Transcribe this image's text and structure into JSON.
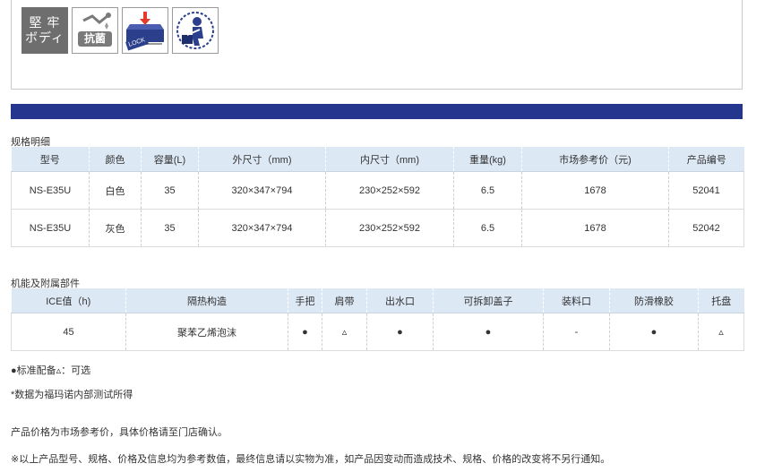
{
  "features": {
    "sturdy_label_line1": "堅 牢",
    "sturdy_label_line2": "ボディ",
    "antibac_label": "抗菌",
    "lock_label": "LOCK"
  },
  "spec": {
    "title": "规格明细",
    "headers": [
      "型号",
      "颜色",
      "容量(L)",
      "外尺寸（mm)",
      "内尺寸（mm)",
      "重量(kg)",
      "市场参考价（元)",
      "产品编号"
    ],
    "rows": [
      [
        "NS-E35U",
        "白色",
        "35",
        "320×347×794",
        "230×252×592",
        "6.5",
        "1678",
        "52041"
      ],
      [
        "NS-E35U",
        "灰色",
        "35",
        "320×347×794",
        "230×252×592",
        "6.5",
        "1678",
        "52042"
      ]
    ]
  },
  "functions": {
    "title": "机能及附属部件",
    "headers": [
      "ICE值（h)",
      "隔热构造",
      "手把",
      "肩带",
      "出水口",
      "可拆卸盖子",
      "装料口",
      "防滑橡胶",
      "托盘"
    ],
    "rows": [
      [
        "45",
        "聚苯乙烯泡沫",
        "●",
        "▵",
        "●",
        "●",
        "-",
        "●",
        "▵"
      ]
    ]
  },
  "notes": {
    "legend": "●标准配备▵：可选",
    "data_source": "*数据为福玛诺内部测试所得",
    "price_note": "产品价格为市场参考价，具体价格请至门店确认。",
    "disclaimer": "※以上产品型号、规格、价格及信息均为参考数值，最终信息请以实物为准，如产品因变动而造成技术、规格、价格的改变将不另行通知。"
  },
  "colors": {
    "accent_bar": "#25368e",
    "header_bg": "#dde8f5"
  }
}
